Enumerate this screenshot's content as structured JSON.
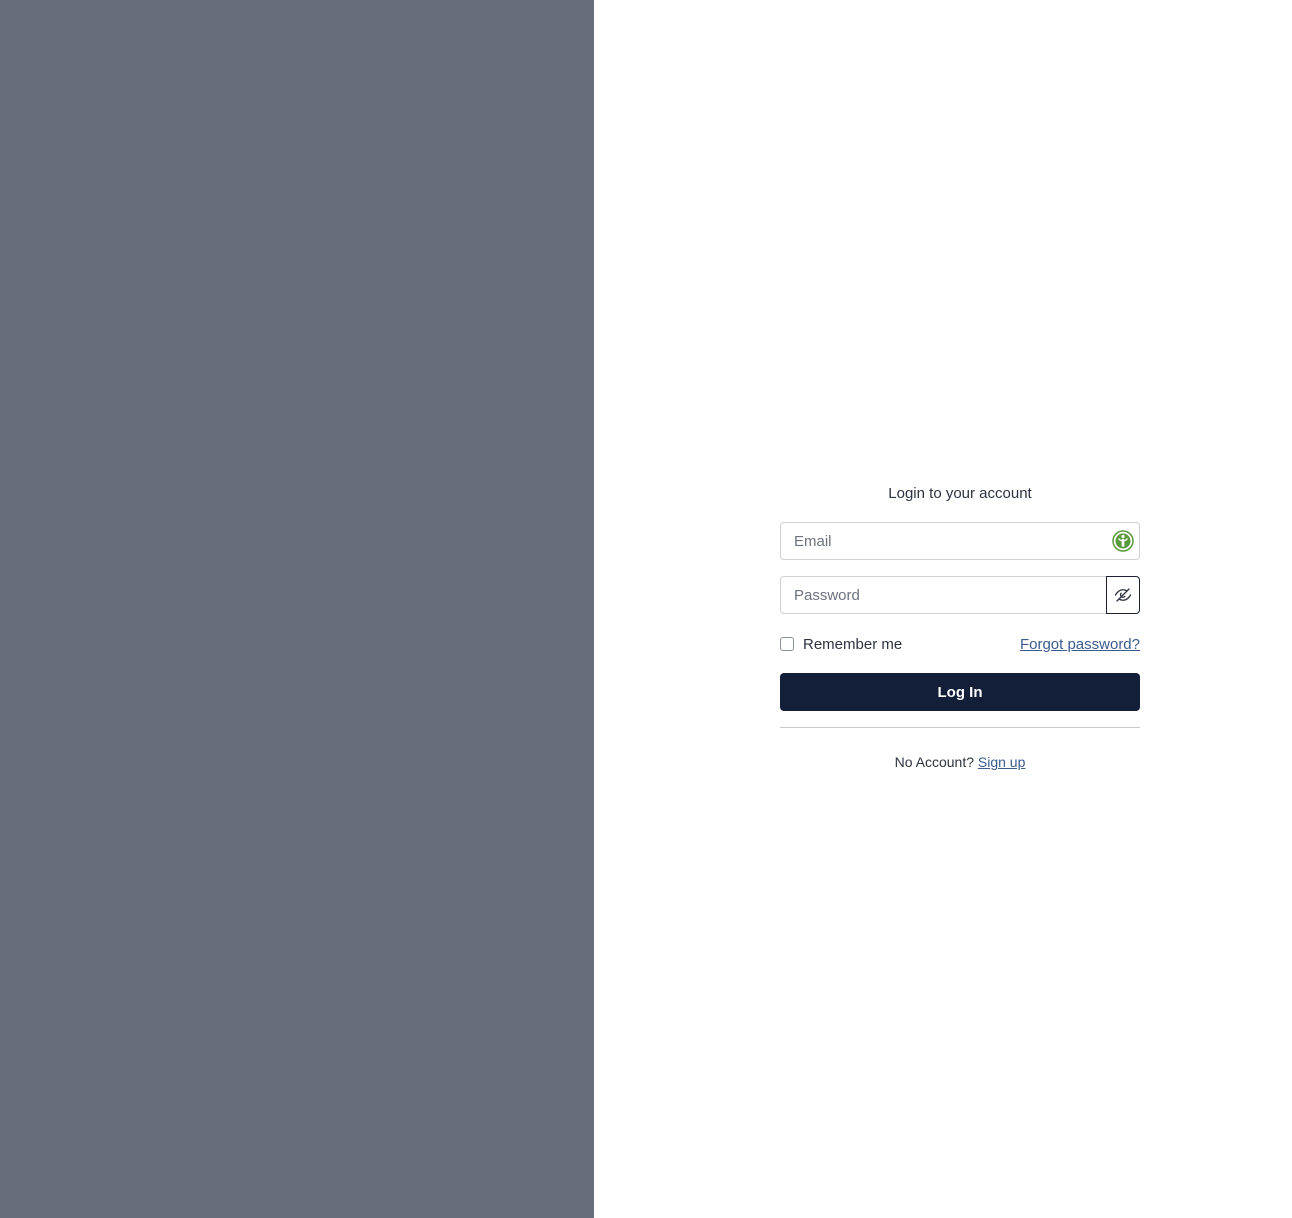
{
  "colors": {
    "left_panel_bg": "#676d7a",
    "primary_button_bg": "#131f38",
    "link": "#3b5b8f",
    "extension_icon": "#5a9a3e"
  },
  "login": {
    "title": "Login to your account",
    "email": {
      "value": "",
      "placeholder": "Email",
      "extension_icon": "password-manager-icon"
    },
    "password": {
      "value": "",
      "placeholder": "Password",
      "toggle_icon": "eye-slash-icon"
    },
    "remember_label": "Remember me",
    "remember_checked": false,
    "forgot_label": "Forgot password?",
    "submit_label": "Log In",
    "signup_prompt": "No Account?",
    "signup_label": "Sign up"
  }
}
